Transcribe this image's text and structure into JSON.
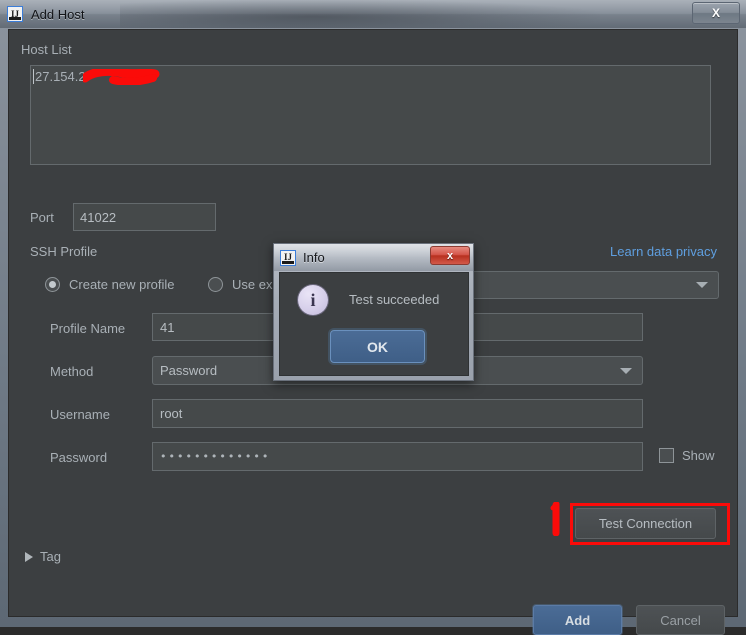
{
  "window": {
    "title": "Add Host",
    "app_icon": "intellij-idea-icon",
    "close_label": "X"
  },
  "form": {
    "host_list_label": "Host List",
    "host_list_value": "27.154.2",
    "host_list_redacted": true,
    "port_label": "Port",
    "port_value": "41022",
    "ssh_profile_label": "SSH Profile",
    "privacy_link": "Learn data privacy",
    "radio_create_new": "Create new profile",
    "radio_use_existing": "Use exi",
    "radio_selected": "create_new",
    "existing_profile_value": "",
    "profile_name_label": "Profile Name",
    "profile_name_value": "41",
    "method_label": "Method",
    "method_value": "Password",
    "username_label": "Username",
    "username_value": "root",
    "password_label": "Password",
    "password_value": "•••••••••••••",
    "show_label": "Show",
    "show_checked": false,
    "test_connection_label": "Test Connection",
    "tag_label": "Tag",
    "tag_expanded": false,
    "add_label": "Add",
    "cancel_label": "Cancel"
  },
  "info_dialog": {
    "title": "Info",
    "app_icon": "intellij-idea-icon",
    "message": "Test succeeded",
    "ok_label": "OK",
    "close_label": "x",
    "icon": "info-circle-icon"
  },
  "annotations": {
    "step_one": "1",
    "highlight_color": "#fb0b09",
    "highlight_target": "test_connection_button"
  },
  "colors": {
    "panel_bg": "#3c3f41",
    "field_bg": "#45494a",
    "text": "#a9b0b6",
    "link": "#5f9fe0",
    "primary_button": "#3f5f87",
    "annotation_red": "#fb0b09"
  }
}
